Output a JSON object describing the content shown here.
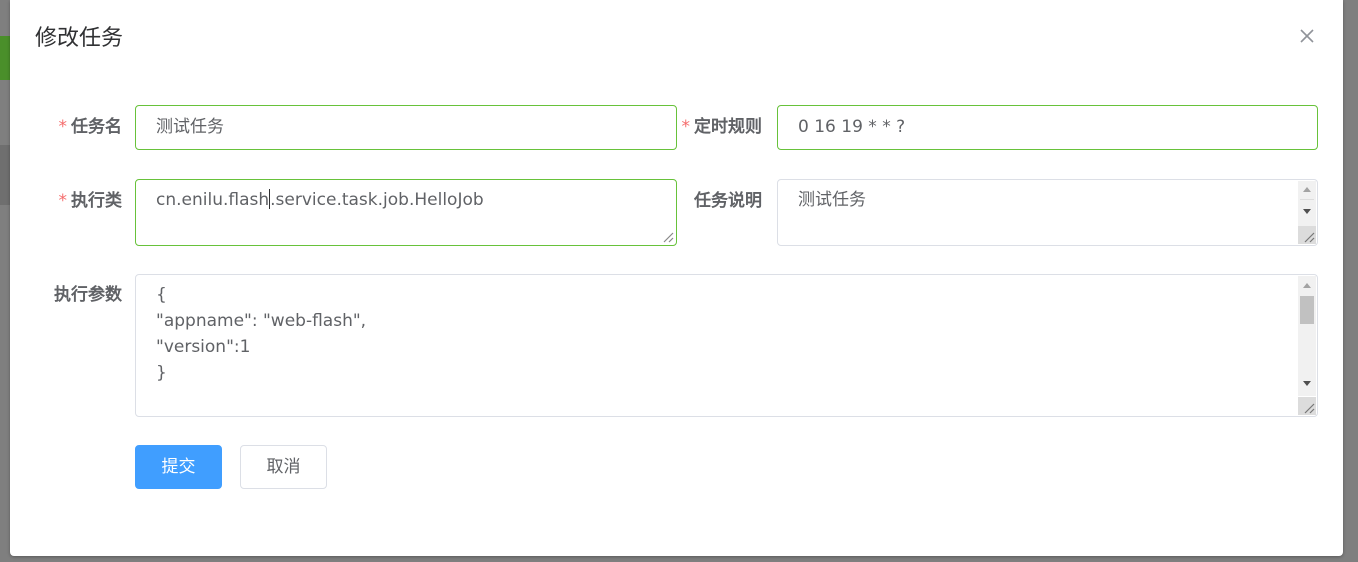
{
  "dialog": {
    "title": "修改任务",
    "close_icon": "close-icon"
  },
  "form": {
    "required_mark": "*",
    "task_name": {
      "label": "任务名",
      "value": "测试任务"
    },
    "cron": {
      "label": "定时规则",
      "value": "0 16 19 * * ?"
    },
    "job_class": {
      "label": "执行类",
      "value_before_caret": "cn.enilu.flash",
      "value_after_caret": ".service.task.job.HelloJob"
    },
    "description": {
      "label": "任务说明",
      "value": "测试任务"
    },
    "params": {
      "label": "执行参数",
      "lines": [
        "{",
        "\"appname\": \"web-flash\",",
        "\"version\":1",
        "}"
      ]
    }
  },
  "buttons": {
    "submit": "提交",
    "cancel": "取消"
  },
  "colors": {
    "primary": "#409eff",
    "valid_border": "#67c23a",
    "required": "#f56c6c"
  }
}
